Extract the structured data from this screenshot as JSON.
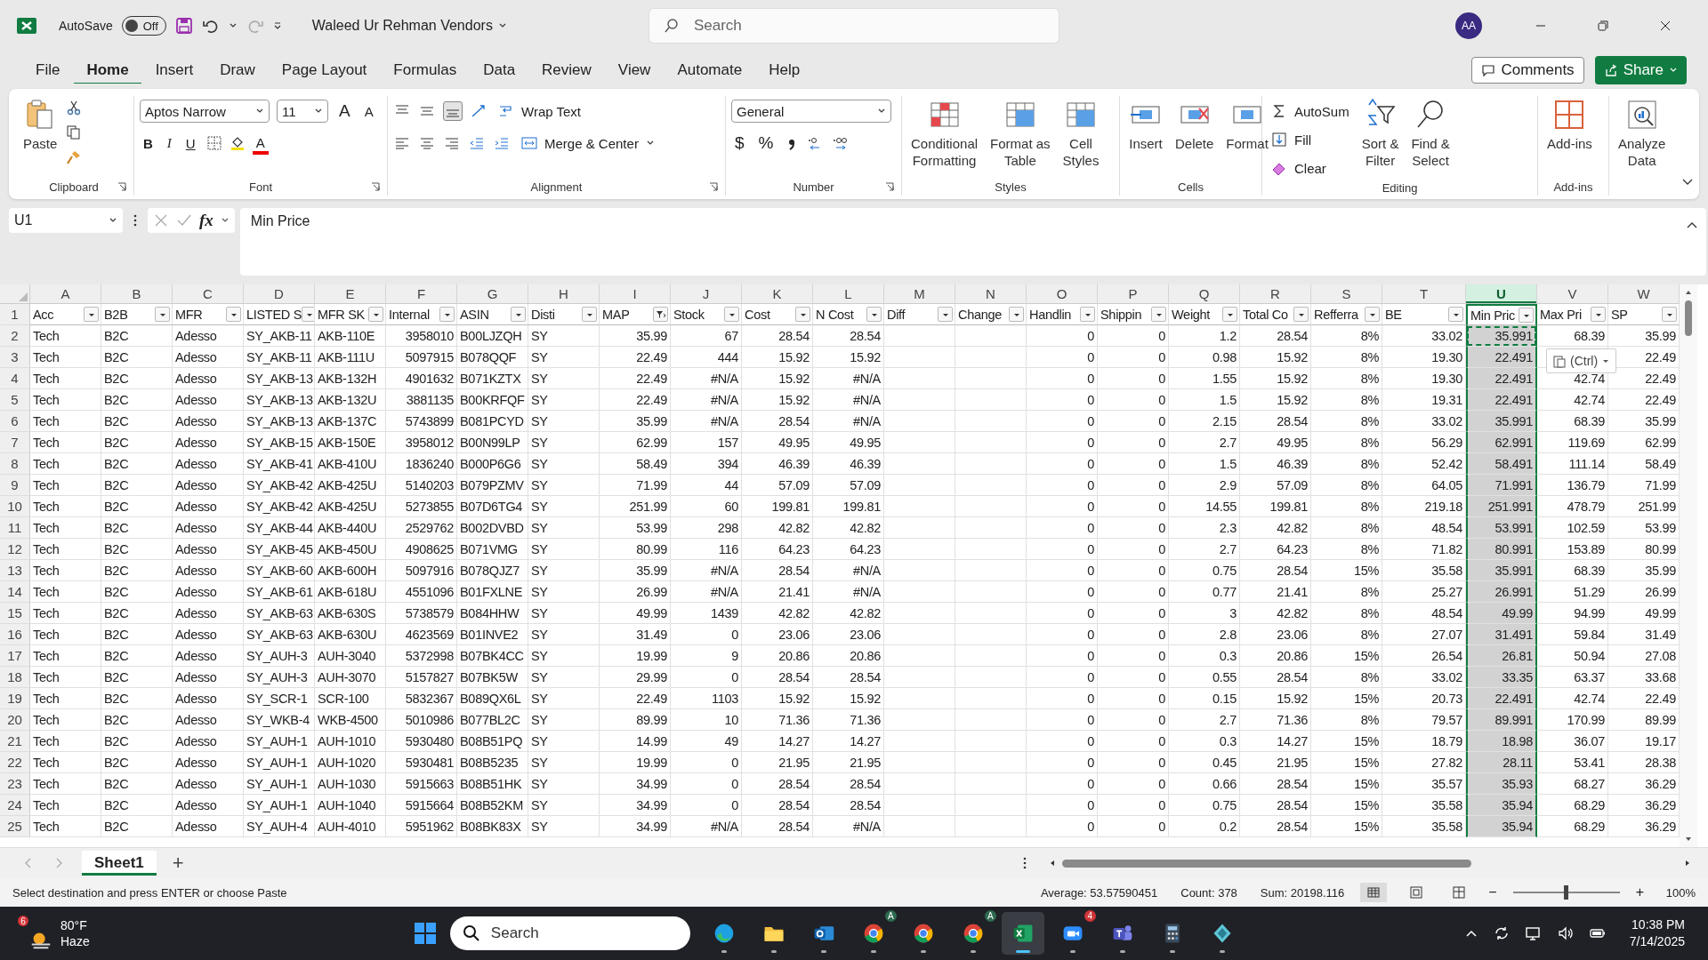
{
  "title_bar": {
    "autosave_label": "AutoSave",
    "autosave": {
      "on": false,
      "text": "Off"
    },
    "document": "Waleed Ur Rehman Vendors",
    "search_placeholder": "Search",
    "avatar": "AA"
  },
  "menu_tabs": [
    {
      "label": "File",
      "selected": false
    },
    {
      "label": "Home",
      "selected": true
    },
    {
      "label": "Insert",
      "selected": false
    },
    {
      "label": "Draw",
      "selected": false
    },
    {
      "label": "Page Layout",
      "selected": false
    },
    {
      "label": "Formulas",
      "selected": false
    },
    {
      "label": "Data",
      "selected": false
    },
    {
      "label": "Review",
      "selected": false
    },
    {
      "label": "View",
      "selected": false
    },
    {
      "label": "Automate",
      "selected": false
    },
    {
      "label": "Help",
      "selected": false
    }
  ],
  "comments_button": "Comments",
  "share_button": "Share",
  "ribbon": {
    "clipboard": {
      "group": "Clipboard",
      "paste": "Paste"
    },
    "font": {
      "group": "Font",
      "family": "Aptos Narrow",
      "size": "11",
      "grow": "A",
      "shrink": "A",
      "bold": "B",
      "italic": "I",
      "underline": "U",
      "color_letter": "A"
    },
    "alignment": {
      "group": "Alignment",
      "wrap_text": "Wrap Text",
      "merge": "Merge & Center"
    },
    "number": {
      "group": "Number",
      "format": "General",
      "currency": "$",
      "percent": "%"
    },
    "styles": {
      "group": "Styles",
      "buttons": [
        [
          "Conditional",
          "Formatting"
        ],
        [
          "Format as",
          "Table"
        ],
        [
          "Cell",
          "Styles"
        ]
      ]
    },
    "cells": {
      "group": "Cells",
      "buttons": [
        "Insert",
        "Delete",
        "Format"
      ]
    },
    "editing": {
      "group": "Editing",
      "autosum": "AutoSum",
      "fill": "Fill",
      "clear": "Clear",
      "sort": [
        "Sort &",
        "Filter"
      ],
      "find": [
        "Find &",
        "Select"
      ]
    },
    "addins": {
      "group": "Add-ins",
      "button": "Add-ins"
    },
    "analyze": {
      "button": [
        "Analyze",
        "Data"
      ]
    }
  },
  "formula_bar": {
    "name_box": "U1",
    "fx": "fx",
    "formula": "Min Price"
  },
  "columns": [
    {
      "letter": "A",
      "header": "Acc",
      "kind": "text",
      "filtered": false,
      "selected": false
    },
    {
      "letter": "B",
      "header": "B2B",
      "kind": "text",
      "filtered": false,
      "selected": false
    },
    {
      "letter": "C",
      "header": "MFR",
      "kind": "text",
      "filtered": false,
      "selected": false
    },
    {
      "letter": "D",
      "header": "LISTED S",
      "kind": "text",
      "filtered": false,
      "selected": false
    },
    {
      "letter": "E",
      "header": "MFR SK",
      "kind": "text",
      "filtered": false,
      "selected": false
    },
    {
      "letter": "F",
      "header": "Internal",
      "kind": "number",
      "filtered": false,
      "selected": false
    },
    {
      "letter": "G",
      "header": "ASIN",
      "kind": "text",
      "filtered": false,
      "selected": false
    },
    {
      "letter": "H",
      "header": "Disti",
      "kind": "text",
      "filtered": false,
      "selected": false
    },
    {
      "letter": "I",
      "header": "MAP",
      "kind": "number",
      "filtered": true,
      "selected": false
    },
    {
      "letter": "J",
      "header": "Stock",
      "kind": "number",
      "filtered": false,
      "selected": false
    },
    {
      "letter": "K",
      "header": "Cost",
      "kind": "number",
      "filtered": false,
      "selected": false
    },
    {
      "letter": "L",
      "header": "N Cost",
      "kind": "number",
      "filtered": false,
      "selected": false
    },
    {
      "letter": "M",
      "header": "Diff",
      "kind": "text",
      "filtered": false,
      "selected": false
    },
    {
      "letter": "N",
      "header": "Change",
      "kind": "text",
      "filtered": false,
      "selected": false
    },
    {
      "letter": "O",
      "header": "Handlin",
      "kind": "number",
      "filtered": false,
      "selected": false
    },
    {
      "letter": "P",
      "header": "Shippin",
      "kind": "number",
      "filtered": false,
      "selected": false
    },
    {
      "letter": "Q",
      "header": "Weight",
      "kind": "number",
      "filtered": false,
      "selected": false
    },
    {
      "letter": "R",
      "header": "Total Co",
      "kind": "number",
      "filtered": false,
      "selected": false
    },
    {
      "letter": "S",
      "header": "Refferra",
      "kind": "number",
      "filtered": false,
      "selected": false
    },
    {
      "letter": "T",
      "header": "BE",
      "kind": "number",
      "filtered": false,
      "selected": false
    },
    {
      "letter": "U",
      "header": "Min Pric",
      "kind": "number",
      "filtered": false,
      "selected": true
    },
    {
      "letter": "V",
      "header": "Max Pri",
      "kind": "number",
      "filtered": false,
      "selected": false
    },
    {
      "letter": "W",
      "header": "SP",
      "kind": "number",
      "filtered": false,
      "selected": false
    }
  ],
  "header_row_num": "1",
  "rows": [
    {
      "num": "2",
      "marquee": true,
      "cells": [
        "Tech",
        "B2C",
        "Adesso",
        "SY_AKB-11",
        "AKB-110E",
        "3958010",
        "B00LJZQH",
        "SY",
        "35.99",
        "67",
        "28.54",
        "28.54",
        null,
        null,
        "0",
        "0",
        "1.2",
        "28.54",
        "8%",
        "33.02",
        "35.991",
        "68.39",
        "35.99"
      ]
    },
    {
      "num": "3",
      "marquee": false,
      "cells": [
        "Tech",
        "B2C",
        "Adesso",
        "SY_AKB-11",
        "AKB-111U",
        "5097915",
        "B078QQF",
        "SY",
        "22.49",
        "444",
        "15.92",
        "15.92",
        null,
        null,
        "0",
        "0",
        "0.98",
        "15.92",
        "8%",
        "19.30",
        "22.491",
        null,
        "22.49"
      ]
    },
    {
      "num": "4",
      "marquee": false,
      "cells": [
        "Tech",
        "B2C",
        "Adesso",
        "SY_AKB-13",
        "AKB-132H",
        "4901632",
        "B071KZTX",
        "SY",
        "22.49",
        "#N/A",
        "15.92",
        "#N/A",
        null,
        null,
        "0",
        "0",
        "1.55",
        "15.92",
        "8%",
        "19.30",
        "22.491",
        "42.74",
        "22.49"
      ]
    },
    {
      "num": "5",
      "marquee": false,
      "cells": [
        "Tech",
        "B2C",
        "Adesso",
        "SY_AKB-13",
        "AKB-132U",
        "3881135",
        "B00KRFQF",
        "SY",
        "22.49",
        "#N/A",
        "15.92",
        "#N/A",
        null,
        null,
        "0",
        "0",
        "1.5",
        "15.92",
        "8%",
        "19.31",
        "22.491",
        "42.74",
        "22.49"
      ]
    },
    {
      "num": "6",
      "marquee": false,
      "cells": [
        "Tech",
        "B2C",
        "Adesso",
        "SY_AKB-13",
        "AKB-137C",
        "5743899",
        "B081PCYD",
        "SY",
        "35.99",
        "#N/A",
        "28.54",
        "#N/A",
        null,
        null,
        "0",
        "0",
        "2.15",
        "28.54",
        "8%",
        "33.02",
        "35.991",
        "68.39",
        "35.99"
      ]
    },
    {
      "num": "7",
      "marquee": false,
      "cells": [
        "Tech",
        "B2C",
        "Adesso",
        "SY_AKB-15",
        "AKB-150E",
        "3958012",
        "B00N99LP",
        "SY",
        "62.99",
        "157",
        "49.95",
        "49.95",
        null,
        null,
        "0",
        "0",
        "2.7",
        "49.95",
        "8%",
        "56.29",
        "62.991",
        "119.69",
        "62.99"
      ]
    },
    {
      "num": "8",
      "marquee": false,
      "cells": [
        "Tech",
        "B2C",
        "Adesso",
        "SY_AKB-41",
        "AKB-410U",
        "1836240",
        "B000P6G6",
        "SY",
        "58.49",
        "394",
        "46.39",
        "46.39",
        null,
        null,
        "0",
        "0",
        "1.5",
        "46.39",
        "8%",
        "52.42",
        "58.491",
        "111.14",
        "58.49"
      ]
    },
    {
      "num": "9",
      "marquee": false,
      "cells": [
        "Tech",
        "B2C",
        "Adesso",
        "SY_AKB-42",
        "AKB-425U",
        "5140203",
        "B079PZMV",
        "SY",
        "71.99",
        "44",
        "57.09",
        "57.09",
        null,
        null,
        "0",
        "0",
        "2.9",
        "57.09",
        "8%",
        "64.05",
        "71.991",
        "136.79",
        "71.99"
      ]
    },
    {
      "num": "10",
      "marquee": false,
      "cells": [
        "Tech",
        "B2C",
        "Adesso",
        "SY_AKB-42",
        "AKB-425U",
        "5273855",
        "B07D6TG4",
        "SY",
        "251.99",
        "60",
        "199.81",
        "199.81",
        null,
        null,
        "0",
        "0",
        "14.55",
        "199.81",
        "8%",
        "219.18",
        "251.991",
        "478.79",
        "251.99"
      ]
    },
    {
      "num": "11",
      "marquee": false,
      "cells": [
        "Tech",
        "B2C",
        "Adesso",
        "SY_AKB-44",
        "AKB-440U",
        "2529762",
        "B002DVBD",
        "SY",
        "53.99",
        "298",
        "42.82",
        "42.82",
        null,
        null,
        "0",
        "0",
        "2.3",
        "42.82",
        "8%",
        "48.54",
        "53.991",
        "102.59",
        "53.99"
      ]
    },
    {
      "num": "12",
      "marquee": false,
      "cells": [
        "Tech",
        "B2C",
        "Adesso",
        "SY_AKB-45",
        "AKB-450U",
        "4908625",
        "B071VMG",
        "SY",
        "80.99",
        "116",
        "64.23",
        "64.23",
        null,
        null,
        "0",
        "0",
        "2.7",
        "64.23",
        "8%",
        "71.82",
        "80.991",
        "153.89",
        "80.99"
      ]
    },
    {
      "num": "13",
      "marquee": false,
      "cells": [
        "Tech",
        "B2C",
        "Adesso",
        "SY_AKB-60",
        "AKB-600H",
        "5097916",
        "B078QJZ7",
        "SY",
        "35.99",
        "#N/A",
        "28.54",
        "#N/A",
        null,
        null,
        "0",
        "0",
        "0.75",
        "28.54",
        "15%",
        "35.58",
        "35.991",
        "68.39",
        "35.99"
      ]
    },
    {
      "num": "14",
      "marquee": false,
      "cells": [
        "Tech",
        "B2C",
        "Adesso",
        "SY_AKB-61",
        "AKB-618U",
        "4551096",
        "B01FXLNE",
        "SY",
        "26.99",
        "#N/A",
        "21.41",
        "#N/A",
        null,
        null,
        "0",
        "0",
        "0.77",
        "21.41",
        "8%",
        "25.27",
        "26.991",
        "51.29",
        "26.99"
      ]
    },
    {
      "num": "15",
      "marquee": false,
      "cells": [
        "Tech",
        "B2C",
        "Adesso",
        "SY_AKB-63",
        "AKB-630S",
        "5738579",
        "B084HHW",
        "SY",
        "49.99",
        "1439",
        "42.82",
        "42.82",
        null,
        null,
        "0",
        "0",
        "3",
        "42.82",
        "8%",
        "48.54",
        "49.99",
        "94.99",
        "49.99"
      ]
    },
    {
      "num": "16",
      "marquee": false,
      "cells": [
        "Tech",
        "B2C",
        "Adesso",
        "SY_AKB-63",
        "AKB-630U",
        "4623569",
        "B01INVE2",
        "SY",
        "31.49",
        "0",
        "23.06",
        "23.06",
        null,
        null,
        "0",
        "0",
        "2.8",
        "23.06",
        "8%",
        "27.07",
        "31.491",
        "59.84",
        "31.49"
      ]
    },
    {
      "num": "17",
      "marquee": false,
      "cells": [
        "Tech",
        "B2C",
        "Adesso",
        "SY_AUH-3",
        "AUH-3040",
        "5372998",
        "B07BK4CC",
        "SY",
        "19.99",
        "9",
        "20.86",
        "20.86",
        null,
        null,
        "0",
        "0",
        "0.3",
        "20.86",
        "15%",
        "26.54",
        "26.81",
        "50.94",
        "27.08"
      ]
    },
    {
      "num": "18",
      "marquee": false,
      "cells": [
        "Tech",
        "B2C",
        "Adesso",
        "SY_AUH-3",
        "AUH-3070",
        "5157827",
        "B07BK5W",
        "SY",
        "29.99",
        "0",
        "28.54",
        "28.54",
        null,
        null,
        "0",
        "0",
        "0.55",
        "28.54",
        "8%",
        "33.02",
        "33.35",
        "63.37",
        "33.68"
      ]
    },
    {
      "num": "19",
      "marquee": false,
      "cells": [
        "Tech",
        "B2C",
        "Adesso",
        "SY_SCR-1",
        "SCR-100",
        "5832367",
        "B089QX6L",
        "SY",
        "22.49",
        "1103",
        "15.92",
        "15.92",
        null,
        null,
        "0",
        "0",
        "0.15",
        "15.92",
        "15%",
        "20.73",
        "22.491",
        "42.74",
        "22.49"
      ]
    },
    {
      "num": "20",
      "marquee": false,
      "cells": [
        "Tech",
        "B2C",
        "Adesso",
        "SY_WKB-4",
        "WKB-4500",
        "5010986",
        "B077BL2C",
        "SY",
        "89.99",
        "10",
        "71.36",
        "71.36",
        null,
        null,
        "0",
        "0",
        "2.7",
        "71.36",
        "8%",
        "79.57",
        "89.991",
        "170.99",
        "89.99"
      ]
    },
    {
      "num": "21",
      "marquee": false,
      "cells": [
        "Tech",
        "B2C",
        "Adesso",
        "SY_AUH-1",
        "AUH-1010",
        "5930480",
        "B08B51PQ",
        "SY",
        "14.99",
        "49",
        "14.27",
        "14.27",
        null,
        null,
        "0",
        "0",
        "0.3",
        "14.27",
        "15%",
        "18.79",
        "18.98",
        "36.07",
        "19.17"
      ]
    },
    {
      "num": "22",
      "marquee": false,
      "cells": [
        "Tech",
        "B2C",
        "Adesso",
        "SY_AUH-1",
        "AUH-1020",
        "5930481",
        "B08B5235",
        "SY",
        "19.99",
        "0",
        "21.95",
        "21.95",
        null,
        null,
        "0",
        "0",
        "0.45",
        "21.95",
        "15%",
        "27.82",
        "28.11",
        "53.41",
        "28.38"
      ]
    },
    {
      "num": "23",
      "marquee": false,
      "cells": [
        "Tech",
        "B2C",
        "Adesso",
        "SY_AUH-1",
        "AUH-1030",
        "5915663",
        "B08B51HK",
        "SY",
        "34.99",
        "0",
        "28.54",
        "28.54",
        null,
        null,
        "0",
        "0",
        "0.66",
        "28.54",
        "15%",
        "35.57",
        "35.93",
        "68.27",
        "36.29"
      ]
    },
    {
      "num": "24",
      "marquee": false,
      "cells": [
        "Tech",
        "B2C",
        "Adesso",
        "SY_AUH-1",
        "AUH-1040",
        "5915664",
        "B08B52KM",
        "SY",
        "34.99",
        "0",
        "28.54",
        "28.54",
        null,
        null,
        "0",
        "0",
        "0.75",
        "28.54",
        "15%",
        "35.58",
        "35.94",
        "68.29",
        "36.29"
      ]
    },
    {
      "num": "25",
      "marquee": false,
      "cells": [
        "Tech",
        "B2C",
        "Adesso",
        "SY_AUH-4",
        "AUH-4010",
        "5951962",
        "B08BK83X",
        "SY",
        "34.99",
        "#N/A",
        "28.54",
        "#N/A",
        null,
        null,
        "0",
        "0",
        "0.2",
        "28.54",
        "15%",
        "35.58",
        "35.94",
        "68.29",
        "36.29"
      ]
    }
  ],
  "paste_options": "(Ctrl)",
  "sheet_tabs": [
    {
      "label": "Sheet1",
      "selected": true
    }
  ],
  "add_sheet": "+",
  "status_bar": {
    "message": "Select destination and press ENTER or choose Paste",
    "average": "Average: 53.57590451",
    "count": "Count: 378",
    "sum": "Sum: 20198.116",
    "zoom_out": "−",
    "zoom_in": "+",
    "zoom_slider": {
      "level": 0.5
    },
    "zoom": "100%"
  },
  "taskbar": {
    "weather": {
      "badge": "6",
      "temp": "80°F",
      "condition": "Haze"
    },
    "search_placeholder": "Search",
    "apps": [
      {
        "kind": "edge",
        "selected": false
      },
      {
        "kind": "folder",
        "selected": false
      },
      {
        "kind": "mail",
        "selected": false
      },
      {
        "kind": "chrome",
        "badge": "A",
        "selected": false
      },
      {
        "kind": "chrome",
        "selected": false
      },
      {
        "kind": "chrome",
        "badge": "A",
        "selected": false
      },
      {
        "kind": "sheet",
        "selected": true
      },
      {
        "kind": "video",
        "badge": "4",
        "selected": false
      },
      {
        "kind": "chat",
        "selected": false
      },
      {
        "kind": "calc",
        "selected": false
      },
      {
        "kind": "diamond",
        "selected": false
      }
    ],
    "time": "10:38 PM",
    "date": "7/14/2025"
  }
}
